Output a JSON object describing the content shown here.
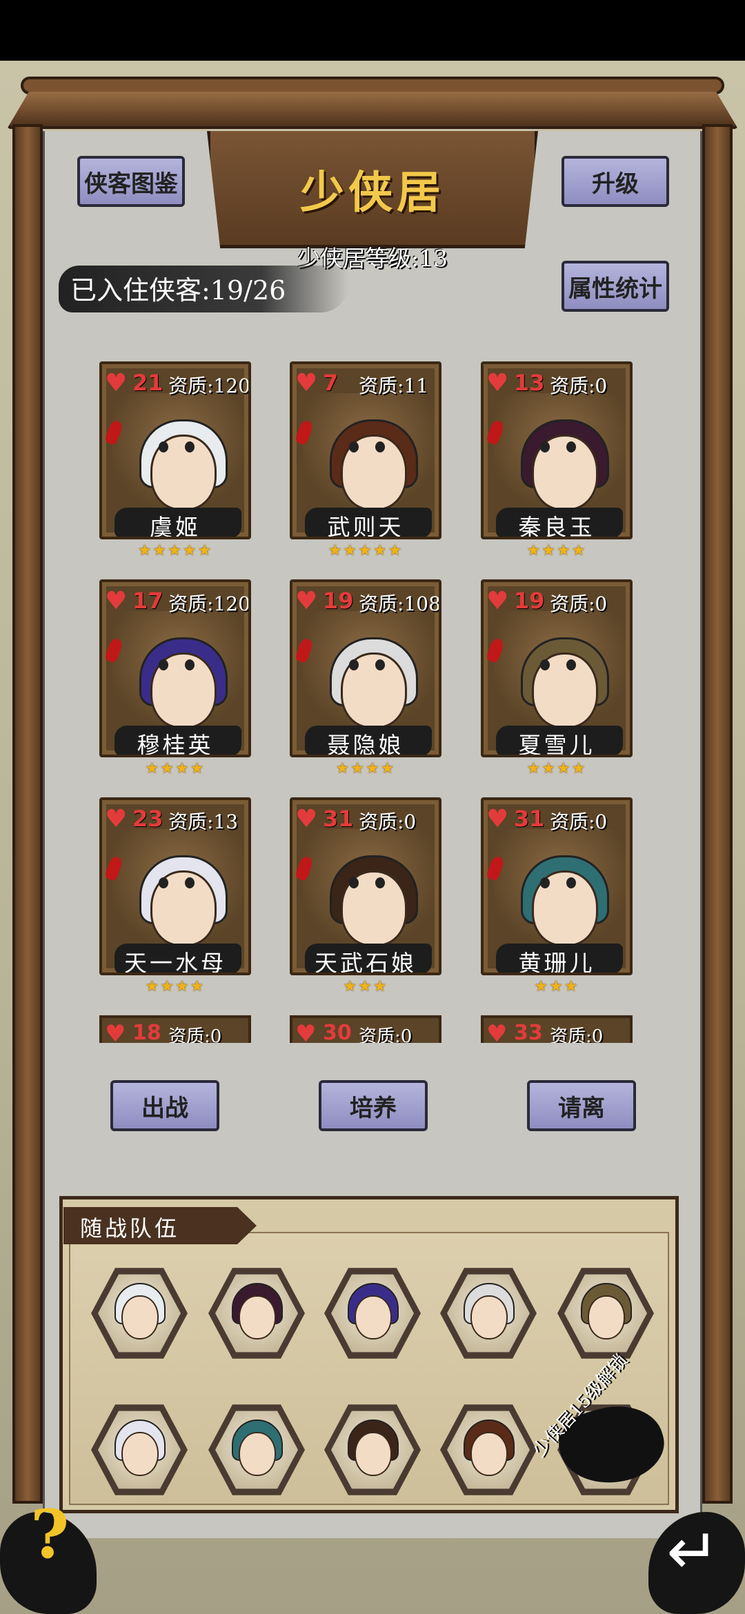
{
  "header": {
    "title": "少侠居",
    "level_text": "少侠居等级:13",
    "resident_count": "已入住侠客:19/26"
  },
  "buttons": {
    "codex": "侠客图鉴",
    "upgrade": "升级",
    "stats": "属性统计",
    "deploy": "出战",
    "train": "培养",
    "dismiss": "请离"
  },
  "heroes": [
    {
      "hp": "21",
      "aptitude": "资质:120",
      "name": "虞姬",
      "stars": "★★★★★",
      "hair": "#e8ecef"
    },
    {
      "hp": "7",
      "aptitude": "资质:11",
      "name": "武则天",
      "stars": "★★★★★",
      "hair": "#5a2b18"
    },
    {
      "hp": "13",
      "aptitude": "资质:0",
      "name": "秦良玉",
      "stars": "★★★★",
      "hair": "#3a1a2e"
    },
    {
      "hp": "17",
      "aptitude": "资质:120",
      "name": "穆桂英",
      "stars": "★★★★",
      "hair": "#3a2d8a"
    },
    {
      "hp": "19",
      "aptitude": "资质:108",
      "name": "聂隐娘",
      "stars": "★★★★",
      "hair": "#dcdcdc"
    },
    {
      "hp": "19",
      "aptitude": "资质:0",
      "name": "夏雪儿",
      "stars": "★★★★",
      "hair": "#6b5a36"
    },
    {
      "hp": "23",
      "aptitude": "资质:13",
      "name": "天一水母",
      "stars": "★★★★",
      "hair": "#e4e4ee"
    },
    {
      "hp": "31",
      "aptitude": "资质:0",
      "name": "天武石娘",
      "stars": "★★★",
      "hair": "#3b2418"
    },
    {
      "hp": "31",
      "aptitude": "资质:0",
      "name": "黄珊儿",
      "stars": "★★★",
      "hair": "#2e6f74"
    }
  ],
  "partial_heroes": [
    {
      "hp": "18",
      "aptitude": "资质:0"
    },
    {
      "hp": "30",
      "aptitude": "资质:0"
    },
    {
      "hp": "33",
      "aptitude": "资质:0"
    }
  ],
  "team": {
    "title": "随战队伍",
    "locked_text": "少侠居15级解锁",
    "members": [
      {
        "hair": "#e8ecef"
      },
      {
        "hair": "#3a1a2e"
      },
      {
        "hair": "#3a2d8a"
      },
      {
        "hair": "#dcdcdc"
      },
      {
        "hair": "#6b5a36"
      },
      {
        "hair": "#e4e4ee"
      },
      {
        "hair": "#2e6f74"
      },
      {
        "hair": "#3b2418"
      },
      {
        "hair": "#5a2b18"
      }
    ]
  },
  "icons": {
    "heart": "heart-icon",
    "help": "question-mark-icon",
    "back": "return-arrow-icon"
  }
}
